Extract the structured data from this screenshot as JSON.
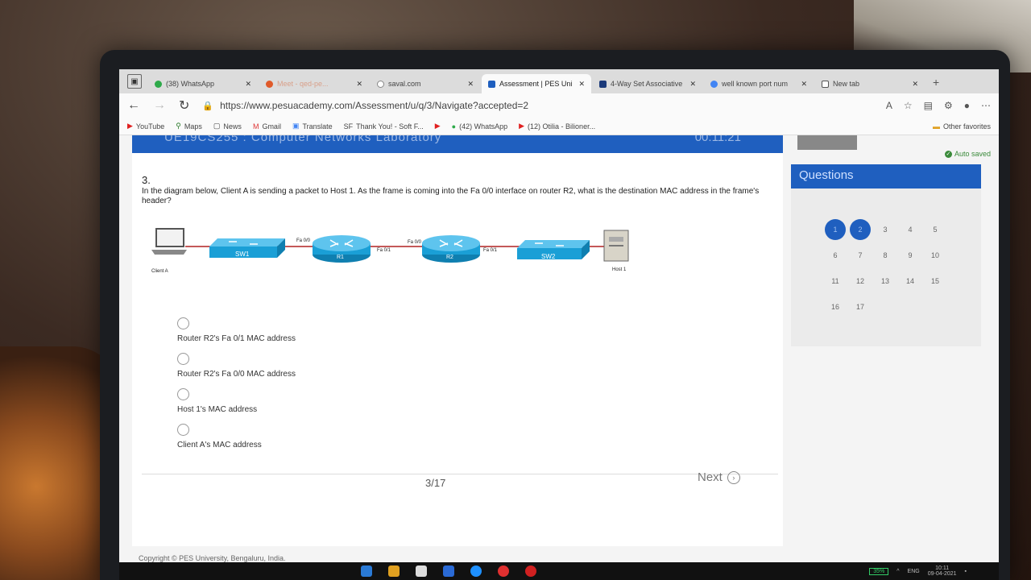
{
  "browser": {
    "tabs": [
      {
        "title": "(38) WhatsApp",
        "icon": "whatsapp-icon",
        "color": "#2eaa4a",
        "active": false
      },
      {
        "title": "Meet - qed-pe...",
        "icon": "meet-icon",
        "color": "#e05a2a",
        "active": false
      },
      {
        "title": "saval.com",
        "icon": "page-icon",
        "color": "#888888",
        "active": false
      },
      {
        "title": "Assessment | PES Uni",
        "icon": "pes-icon",
        "color": "#1f5fbf",
        "active": true
      },
      {
        "title": "4-Way Set Associative",
        "icon": "nptel-icon",
        "color": "#1b3a7a",
        "active": false
      },
      {
        "title": "well known port num",
        "icon": "google-icon",
        "color": "#4285f4",
        "active": false
      },
      {
        "title": "New tab",
        "icon": "newtab-icon",
        "color": "#555555",
        "active": false
      }
    ],
    "url": "https://www.pesuacademy.com/Assessment/u/q/3/Navigate?accepted=2",
    "bookmarks": [
      {
        "label": "YouTube",
        "color": "#e02020"
      },
      {
        "label": "Maps",
        "color": "#2a7a2a"
      },
      {
        "label": "News",
        "color": "#444444"
      },
      {
        "label": "Gmail",
        "color": "#d33"
      },
      {
        "label": "Translate",
        "color": "#4285f4"
      },
      {
        "label": "Thank You! - Soft F...",
        "color": "#888888"
      },
      {
        "label": "",
        "color": "#e02020"
      },
      {
        "label": "(42) WhatsApp",
        "color": "#2eaa4a"
      },
      {
        "label": "(12) Otilia - Bilioner...",
        "color": "#e02020"
      }
    ],
    "other_favorites": "Other favorites"
  },
  "page": {
    "course_title": "UE19CS255 : Computer Networks Laboratory",
    "timer": "00:11:21",
    "question_number": "3.",
    "question_text": "In the diagram below, Client A is sending a packet to Host 1. As the frame is coming into the Fa 0/0 interface on router R2, what is the destination MAC address in the frame's header?",
    "diagram": {
      "devices": [
        "Client A",
        "SW1",
        "R1",
        "R2",
        "SW2",
        "Host 1"
      ],
      "interfaces": [
        "Fa 0/0",
        "Fa 0/1",
        "Fa 0/0",
        "Fa 0/1"
      ]
    },
    "options": [
      "Router R2's Fa 0/1 MAC address",
      "Router R2's Fa 0/0 MAC address",
      "Host 1's MAC address",
      "Client A's MAC address"
    ],
    "progress": "3/17",
    "next_label": "Next",
    "footer": "Copyright © PES University, Bengaluru, India."
  },
  "sidebar": {
    "autosave": "Auto saved",
    "questions_title": "Questions",
    "questions": [
      "1",
      "2",
      "3",
      "4",
      "5",
      "6",
      "7",
      "8",
      "9",
      "10",
      "11",
      "12",
      "13",
      "14",
      "15",
      "16",
      "17"
    ],
    "answered": [
      1,
      2
    ]
  },
  "taskbar": {
    "battery": "35%",
    "lang": "ENG",
    "time": "10:11",
    "date": "09-04-2021"
  }
}
